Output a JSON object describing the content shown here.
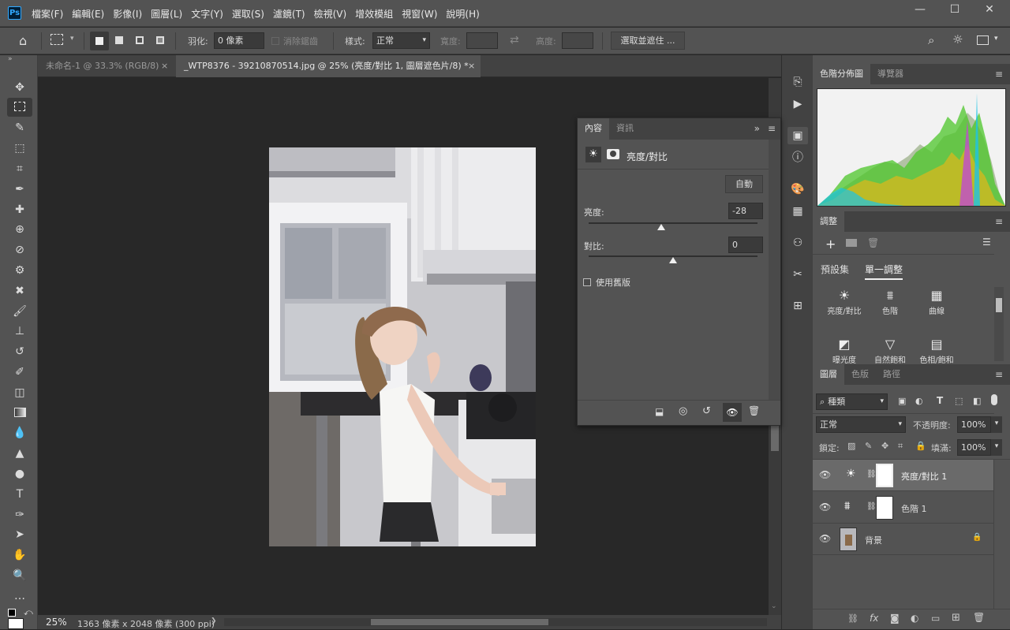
{
  "app": {
    "logo": "Ps"
  },
  "menu": [
    "檔案(F)",
    "編輯(E)",
    "影像(I)",
    "圖層(L)",
    "文字(Y)",
    "選取(S)",
    "濾鏡(T)",
    "檢視(V)",
    "增效模組",
    "視窗(W)",
    "說明(H)"
  ],
  "window_controls": {
    "minimize": "—",
    "maximize": "☐",
    "close": "✕"
  },
  "options": {
    "feather_label": "羽化:",
    "feather_value": "0 像素",
    "antialias_label": "消除鋸齒",
    "style_label": "樣式:",
    "style_value": "正常",
    "width_label": "寬度:",
    "height_label": "高度:",
    "select_mask_button": "選取並遮住 ..."
  },
  "tabs": [
    {
      "label": "未命名-1 @ 33.3% (RGB/8)",
      "close": "×",
      "active": false
    },
    {
      "label": "_WTP8376 - 39210870514.jpg @ 25% (亮度/對比 1, 圖層遮色片/8) *",
      "close": "×",
      "active": true
    }
  ],
  "status": {
    "zoom": "25%",
    "doc_info": "1363 像素 x 2048 像素 (300 ppi)",
    "arrow": "❯"
  },
  "properties": {
    "tabs": [
      "內容",
      "資訊"
    ],
    "title": "亮度/對比",
    "auto_button": "自動",
    "brightness_label": "亮度:",
    "brightness_value": "-28",
    "brightness_level": 0.43,
    "contrast_label": "對比:",
    "contrast_value": "0",
    "contrast_level": 0.5,
    "legacy_label": "使用舊版"
  },
  "histogram": {
    "tabs": [
      "色階分佈圖",
      "導覽器"
    ]
  },
  "adjustments": {
    "panel_tab": "調整",
    "subtabs": [
      "預設集",
      "單一調整"
    ],
    "items": [
      {
        "label": "亮度/對比",
        "icon": "☀"
      },
      {
        "label": "色階",
        "icon": "⩩"
      },
      {
        "label": "曲線",
        "icon": "▦"
      },
      {
        "label": "曝光度",
        "icon": "◩"
      },
      {
        "label": "自然飽和",
        "icon": "▽"
      },
      {
        "label": "色相/飽和",
        "icon": "▤"
      }
    ]
  },
  "layers": {
    "tabs": [
      "圖層",
      "色版",
      "路徑"
    ],
    "filter_value": "種類",
    "blend_mode": "正常",
    "opacity_label": "不透明度:",
    "opacity_value": "100%",
    "lock_label": "鎖定:",
    "fill_label": "填滿:",
    "fill_value": "100%",
    "items": [
      {
        "name": "亮度/對比 1",
        "icon": "☀",
        "selected": true
      },
      {
        "name": "色階 1",
        "icon": "⩩",
        "selected": false
      },
      {
        "name": "背景",
        "icon": "",
        "selected": false
      }
    ]
  },
  "colors": {
    "accent": "#31a8ff",
    "panel": "#535353",
    "dark": "#424242",
    "canvas": "#282828"
  }
}
